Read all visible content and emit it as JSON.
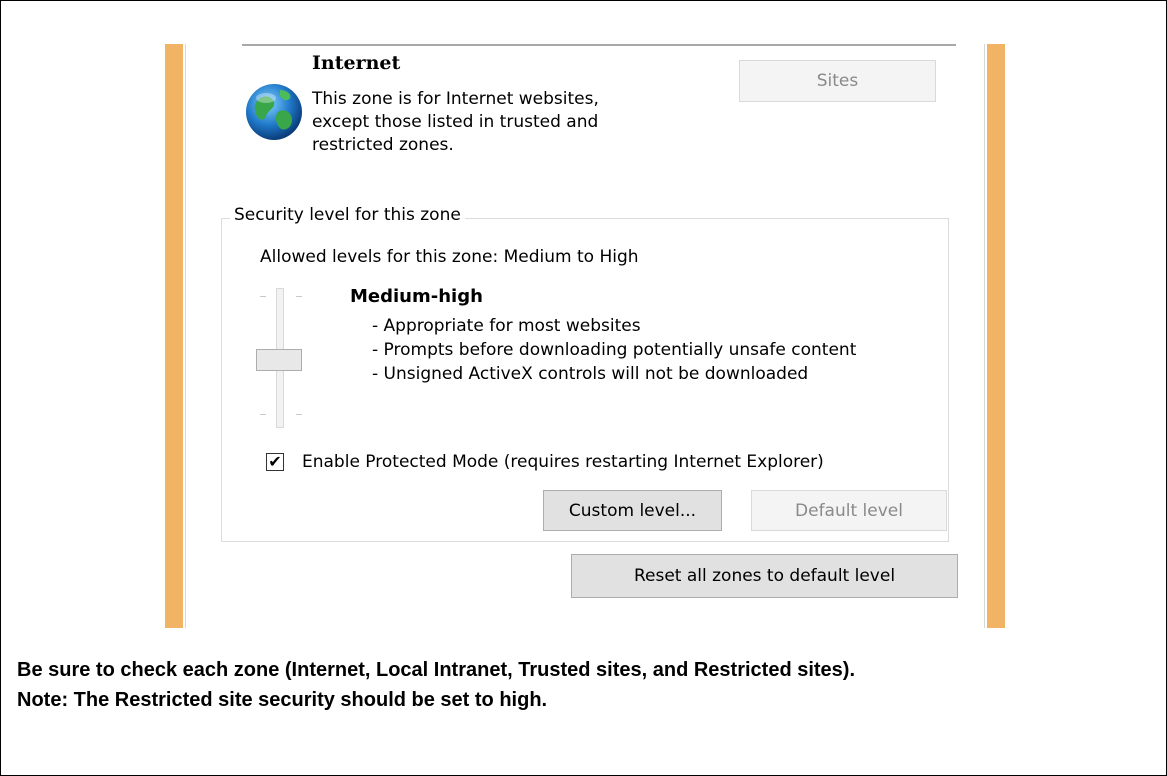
{
  "zone": {
    "name": "Internet",
    "description_lines": [
      "This zone is for Internet websites,",
      "except those listed in trusted and",
      "restricted zones."
    ],
    "icon": "globe-icon",
    "sites_label": "Sites"
  },
  "security": {
    "group_label": "Security level for this zone",
    "allowed_levels": "Allowed levels for this zone: Medium to High",
    "level_name": "Medium-high",
    "level_details": [
      "- Appropriate for most websites",
      "- Prompts before downloading potentially unsafe content",
      "- Unsigned ActiveX controls will not be downloaded"
    ],
    "slider_position_fraction": 0.5,
    "protected_mode_checked": true,
    "protected_mode_label": "Enable Protected Mode (requires restarting Internet Explorer)",
    "custom_level_label": "Custom level...",
    "default_level_label": "Default level",
    "reset_all_label": "Reset all zones to default level"
  },
  "note": {
    "line1": "Be sure to check each zone (Internet, Local Intranet, Trusted sites, and Restricted sites).",
    "line2": "Note: The Restricted site security should be set to high."
  },
  "colors": {
    "accent_border": "#f0b464",
    "button_bg": "#e1e1e1",
    "disabled_text": "#8a8a8a"
  }
}
